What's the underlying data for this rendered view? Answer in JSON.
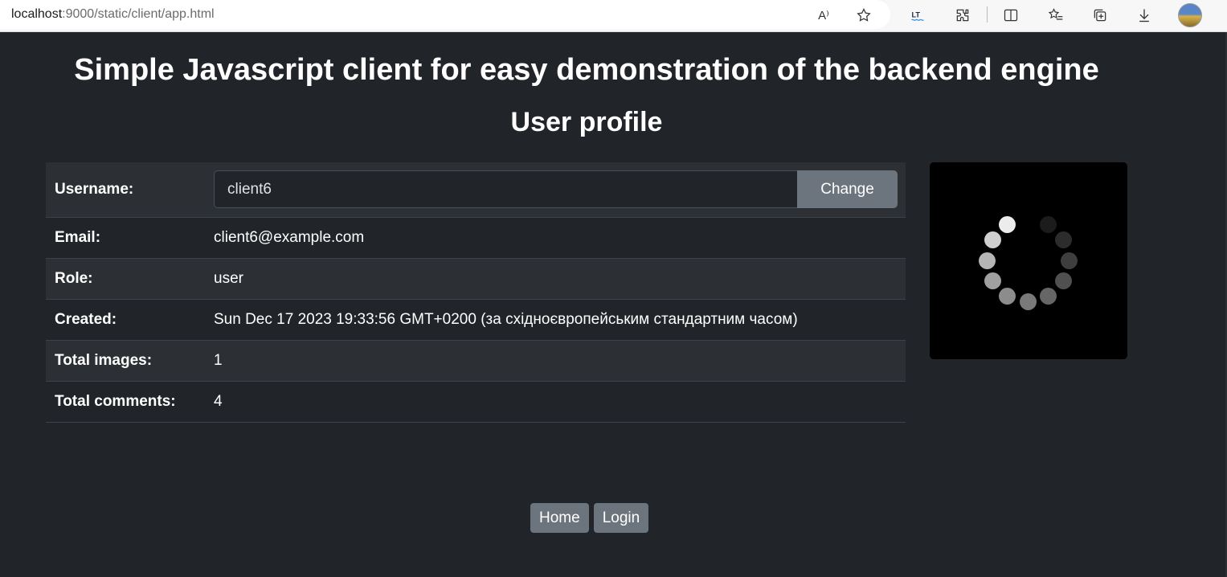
{
  "browser": {
    "url_host": "localhost",
    "url_rest": ":9000/static/client/app.html",
    "read_aloud_glyph": "A⁾"
  },
  "page": {
    "title": "Simple Javascript client for easy demonstration of the backend engine",
    "subtitle": "User profile"
  },
  "profile": {
    "username_label": "Username:",
    "username_value": "client6",
    "change_label": "Change",
    "email_label": "Email:",
    "email_value": "client6@example.com",
    "role_label": "Role:",
    "role_value": "user",
    "created_label": "Created:",
    "created_value": "Sun Dec 17 2023 19:33:56 GMT+0200 (за східноєвропейським стандартним часом)",
    "images_label": "Total images:",
    "images_value": "1",
    "comments_label": "Total comments:",
    "comments_value": "4"
  },
  "nav": {
    "home_label": "Home",
    "login_label": "Login"
  },
  "colors": {
    "background": "#212529",
    "row_stripe": "#2c3034",
    "button": "#6c757d"
  }
}
